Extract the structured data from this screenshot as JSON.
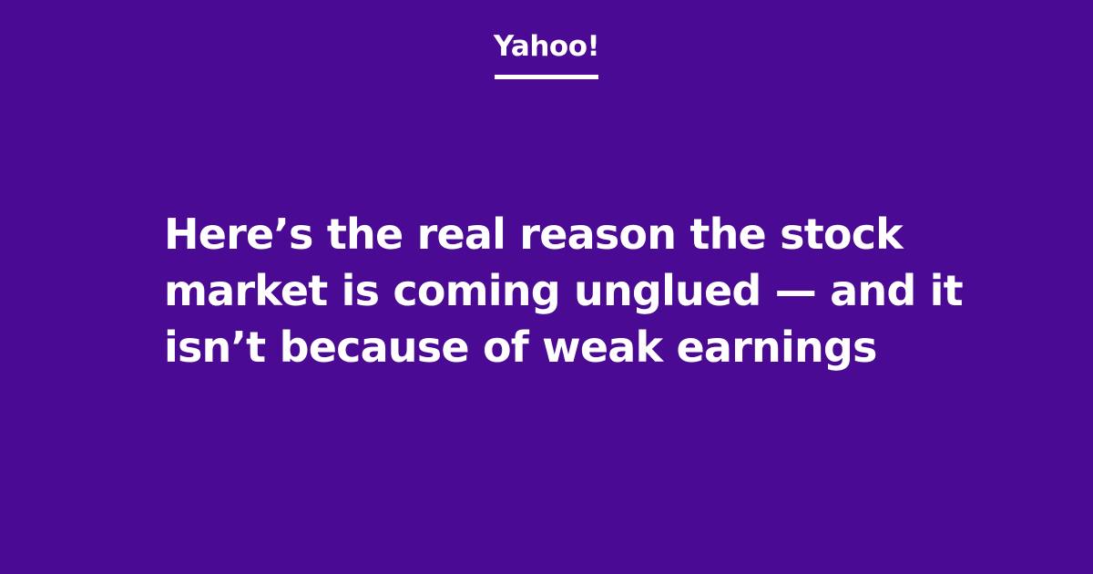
{
  "brand": {
    "name": "Yahoo!"
  },
  "article": {
    "headline": "Here’s the real reason the stock market is coming unglued — and it isn’t because of weak earnings"
  },
  "colors": {
    "background": "#4a0a93",
    "text": "#ffffff"
  }
}
